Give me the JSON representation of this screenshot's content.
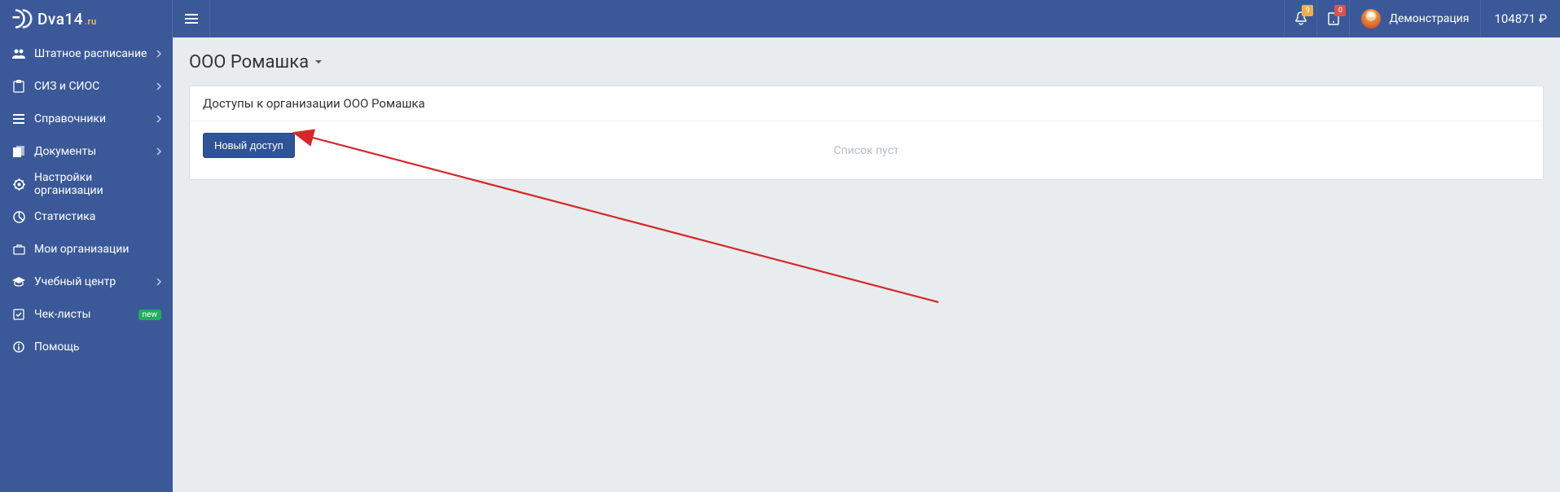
{
  "brand": {
    "name": "Dva14",
    "tld": ".ru"
  },
  "topbar": {
    "notif_badge": "9",
    "nav_badge": "0",
    "user_name": "Демонстрация",
    "balance": "104871",
    "currency": "₽"
  },
  "sidebar": {
    "items": [
      {
        "icon": "users",
        "label": "Штатное расписание",
        "chevron": true
      },
      {
        "icon": "clipboard",
        "label": "СИЗ и СИОС",
        "chevron": true
      },
      {
        "icon": "list",
        "label": "Справочники",
        "chevron": true
      },
      {
        "icon": "docs",
        "label": "Документы",
        "chevron": true
      },
      {
        "icon": "gear",
        "label": "Настройки организации",
        "chevron": false
      },
      {
        "icon": "chart",
        "label": "Статистика",
        "chevron": false
      },
      {
        "icon": "briefcase",
        "label": "Мои организации",
        "chevron": false
      },
      {
        "icon": "grad",
        "label": "Учебный центр",
        "chevron": true
      },
      {
        "icon": "check",
        "label": "Чек-листы",
        "chevron": false,
        "badge": "new"
      },
      {
        "icon": "info",
        "label": "Помощь",
        "chevron": false
      }
    ]
  },
  "page": {
    "title": "ООО Ромашка",
    "card_title": "Доступы к организации ООО Ромашка",
    "new_access_btn": "Новый доступ",
    "empty": "Список пуст"
  }
}
